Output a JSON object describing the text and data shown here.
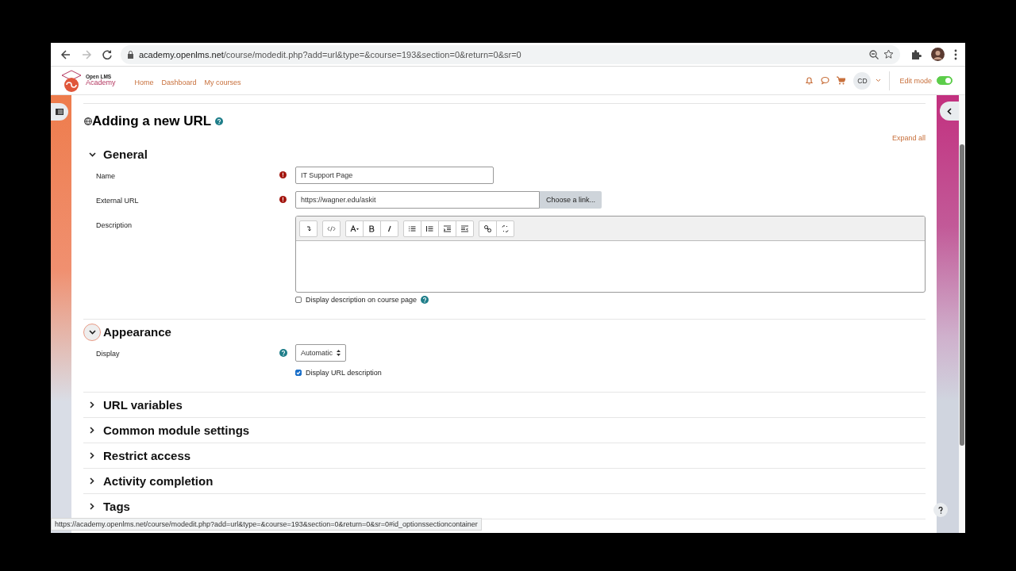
{
  "browser": {
    "host": "academy.openlms.net",
    "path": "/course/modedit.php?add=url&type=&course=193&section=0&return=0&sr=0",
    "forward_disabled": true
  },
  "site_nav": {
    "logo_top": "Open LMS",
    "logo_bottom": "Academy",
    "links": [
      "Home",
      "Dashboard",
      "My courses"
    ],
    "user_initials": "CD",
    "edit_mode": {
      "label": "Edit mode",
      "on": true
    }
  },
  "page": {
    "title": "Adding a new URL",
    "expand_all": "Expand all"
  },
  "sections": [
    {
      "title": "General",
      "expanded": true,
      "focused": false,
      "fields": [
        {
          "kind": "text",
          "label": "Name",
          "required": true,
          "value": "IT Support Page"
        },
        {
          "kind": "url",
          "label": "External URL",
          "required": true,
          "value": "https://wagner.edu/askit",
          "button": "Choose a link..."
        },
        {
          "kind": "editor",
          "label": "Description"
        },
        {
          "kind": "checkbox",
          "label": "Display description on course page",
          "checked": false,
          "help": true
        }
      ]
    },
    {
      "title": "Appearance",
      "expanded": true,
      "focused": true,
      "fields": [
        {
          "kind": "select",
          "label": "Display",
          "value": "Automatic",
          "help": true
        },
        {
          "kind": "checkbox",
          "label": "Display URL description",
          "checked": true
        }
      ]
    },
    {
      "title": "URL variables",
      "expanded": false,
      "focused": false
    },
    {
      "title": "Common module settings",
      "expanded": false,
      "focused": false
    },
    {
      "title": "Restrict access",
      "expanded": false,
      "focused": false
    },
    {
      "title": "Activity completion",
      "expanded": false,
      "focused": false
    },
    {
      "title": "Tags",
      "expanded": false,
      "focused": false
    }
  ],
  "status_url": "https://academy.openlms.net/course/modedit.php?add=url&type=&course=193&section=0&return=0&sr=0#id_optionssectioncontainer"
}
